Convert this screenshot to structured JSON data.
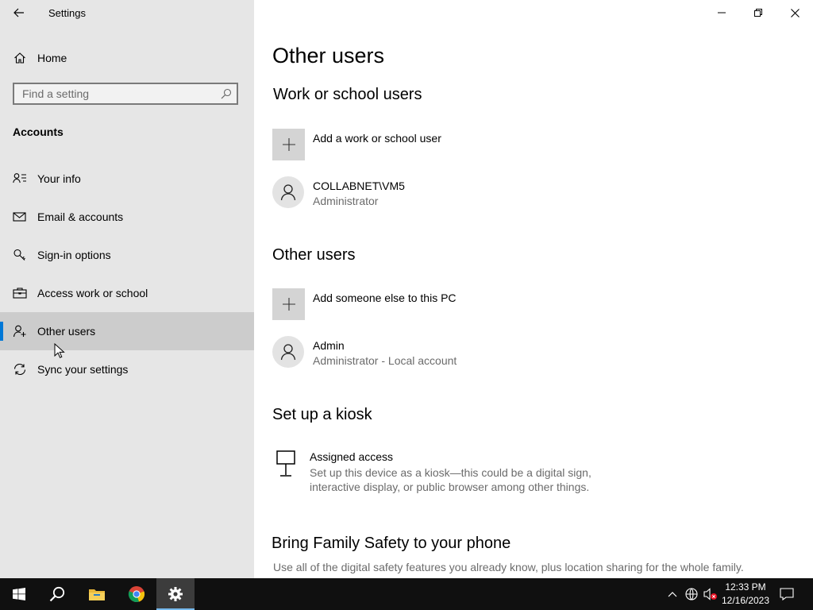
{
  "window": {
    "app_title": "Settings",
    "controls": {
      "minimize": "minimize-icon",
      "restore": "restore-icon",
      "close": "close-icon"
    }
  },
  "sidebar": {
    "home_label": "Home",
    "search_placeholder": "Find a setting",
    "section_title": "Accounts",
    "items": [
      {
        "label": "Your info",
        "icon": "person-info-icon"
      },
      {
        "label": "Email & accounts",
        "icon": "mail-icon"
      },
      {
        "label": "Sign-in options",
        "icon": "key-icon"
      },
      {
        "label": "Access work or school",
        "icon": "briefcase-icon"
      },
      {
        "label": "Other users",
        "icon": "person-add-icon",
        "selected": true
      },
      {
        "label": "Sync your settings",
        "icon": "sync-icon"
      }
    ]
  },
  "main": {
    "title": "Other users",
    "work_section": {
      "heading": "Work or school users",
      "add_label": "Add a work or school user",
      "user": {
        "name": "COLLABNET\\VM5",
        "role": "Administrator"
      }
    },
    "other_section": {
      "heading": "Other users",
      "add_label": "Add someone else to this PC",
      "user": {
        "name": "Admin",
        "role": "Administrator - Local account"
      }
    },
    "kiosk_section": {
      "heading": "Set up a kiosk",
      "title": "Assigned access",
      "description": "Set up this device as a kiosk—this could be a digital sign, interactive display, or public browser among other things."
    },
    "family_section": {
      "heading": "Bring Family Safety to your phone",
      "description": "Use all of the digital safety features you already know, plus location sharing for the whole family."
    }
  },
  "taskbar": {
    "apps": [
      "windows-start-icon",
      "search-icon",
      "file-explorer-icon",
      "chrome-icon",
      "settings-gear-icon"
    ],
    "active_app": "settings-gear-icon",
    "tray": [
      "chevron-up-icon",
      "network-icon",
      "volume-muted-icon",
      "notification-icon"
    ],
    "time": "12:33 PM",
    "date": "12/16/2023"
  },
  "colors": {
    "sidebar_bg": "#e6e6e6",
    "selected_bg": "#cccccc",
    "accent": "#0078d7",
    "taskbar_bg": "#101010"
  }
}
